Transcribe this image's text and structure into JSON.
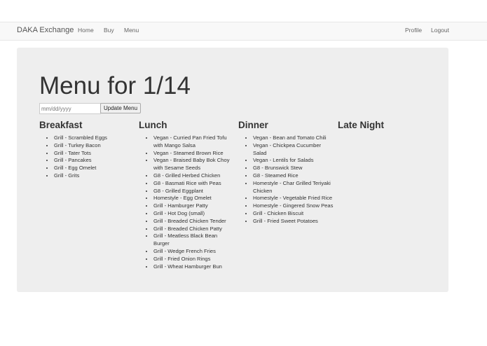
{
  "navbar": {
    "brand": "DAKA Exchange",
    "left_links": [
      "Home",
      "Buy",
      "Menu"
    ],
    "right_links": [
      "Profile",
      "Logout"
    ]
  },
  "main": {
    "title": "Menu for 1/14",
    "date_input": {
      "placeholder": "mm/dd/yyyy",
      "value": ""
    },
    "update_button": "Update Menu",
    "meals": [
      {
        "name": "Breakfast",
        "items": [
          "Grill - Scrambled Eggs",
          "Grill - Turkey Bacon",
          "Grill - Tater Tots",
          "Grill - Pancakes",
          "Grill - Egg Omelet",
          "Grill - Grits"
        ]
      },
      {
        "name": "Lunch",
        "items": [
          "Vegan - Curried Pan Fried Tofu with Mango Salsa",
          "Vegan - Steamed Brown Rice",
          "Vegan - Braised Baby Bok Choy with Sesame Seeds",
          "G8 - Grilled Herbed Chicken",
          "G8 - Basmati Rice with Peas",
          "G8 - Grilled Eggplant",
          "Homestyle - Egg Omelet",
          "Grill - Hamburger Patty",
          "Grill - Hot Dog (small)",
          "Grill - Breaded Chicken Tender",
          "Grill - Breaded Chicken Patty",
          "Grill - Meatless Black Bean Burger",
          "Grill - Wedge French Fries",
          "Grill - Fried Onion Rings",
          "Grill - Wheat Hamburger Bun"
        ]
      },
      {
        "name": "Dinner",
        "items": [
          "Vegan - Bean and Tomato Chili",
          "Vegan - Chickpea Cucumber Salad",
          "Vegan - Lentils for Salads",
          "G8 - Brunswick Stew",
          "G8 - Steamed Rice",
          "Homestyle - Char Grilled Teriyaki Chicken",
          "Homestyle - Vegetable Fried Rice",
          "Homestyle - Gingered Snow Peas",
          "Grill - Chicken Biscuit",
          "Grill - Fried Sweet Potatoes"
        ]
      },
      {
        "name": "Late Night",
        "items": []
      }
    ]
  }
}
